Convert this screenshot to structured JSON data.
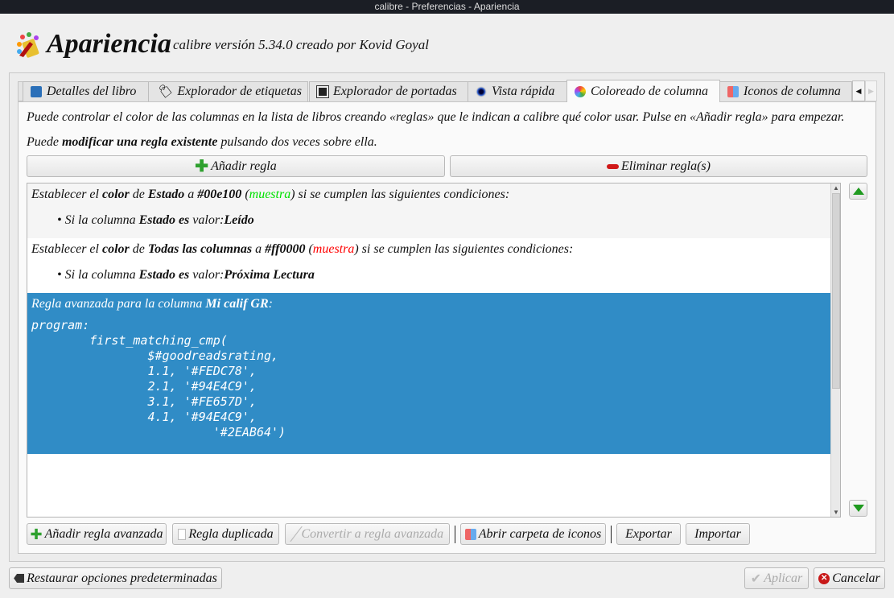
{
  "window_title": "calibre - Preferencias - Apariencia",
  "header": {
    "title": "Apariencia",
    "subtitle": "calibre versión 5.34.0 creado por Kovid Goyal"
  },
  "tabs": [
    {
      "label": "Detalles del libro",
      "icon": "book-icon"
    },
    {
      "label": "Explorador de etiquetas",
      "icon": "tag-icon"
    },
    {
      "label": "Explorador de portadas",
      "icon": "cover-icon"
    },
    {
      "label": "Vista rápida",
      "icon": "eye-icon"
    },
    {
      "label": "Coloreado de columna",
      "icon": "palette-icon",
      "active": true
    },
    {
      "label": "Iconos de columna",
      "icon": "icons-icon"
    }
  ],
  "intro": {
    "line1": "Puede controlar el color de las columnas en la lista de libros creando «reglas» que le indican a calibre qué color usar. Pulse en «Añadir regla» para empezar.",
    "line2_pre": "Puede ",
    "line2_bold": "modificar una regla existente",
    "line2_post": " pulsando dos veces sobre ella."
  },
  "buttons": {
    "add_rule": "Añadir regla",
    "delete_rule": "Eliminar regla(s)"
  },
  "rules": [
    {
      "p1": "Establecer el ",
      "color_word": "color",
      "p2": " de ",
      "column": "Estado",
      "p3": " a ",
      "hex": "#00e100",
      "sample": "muestra",
      "sample_color": "#00e100",
      "p4": " si se cumplen las siguientes condiciones:",
      "cond_pre": "Si la columna ",
      "cond_col": "Estado es",
      "cond_mid": " valor:",
      "cond_val": "Leído"
    },
    {
      "p1": "Establecer el ",
      "color_word": "color",
      "p2": " de ",
      "column": "Todas las columnas",
      "p3": " a ",
      "hex": "#ff0000",
      "sample": "muestra",
      "sample_color": "#ff0000",
      "p4": " si se cumplen las siguientes condiciones:",
      "cond_pre": "Si la columna ",
      "cond_col": "Estado es",
      "cond_mid": " valor:",
      "cond_val": "Próxima Lectura"
    }
  ],
  "advanced_rule": {
    "pre": "Regla avanzada para la columna ",
    "column": "Mi calif GR",
    "post": ":",
    "code": "program:\n        first_matching_cmp(\n                $#goodreadsrating,\n                1.1, '#FEDC78',\n                2.1, '#94E4C9',\n                3.1, '#FE657D',\n                4.1, '#94E4C9',\n                         '#2EAB64')"
  },
  "bottom_buttons": {
    "add_advanced": "Añadir regla avanzada",
    "duplicate": "Regla duplicada",
    "convert": "Convertir a regla avanzada",
    "open_icons": "Abrir carpeta de iconos",
    "export": "Exportar",
    "import": "Importar"
  },
  "footer": {
    "restore": "Restaurar opciones predeterminadas",
    "apply": "Aplicar",
    "cancel": "Cancelar"
  },
  "colors": {
    "selection": "#308cc6",
    "add_green": "#2ea02e",
    "remove_red": "#d01818"
  }
}
